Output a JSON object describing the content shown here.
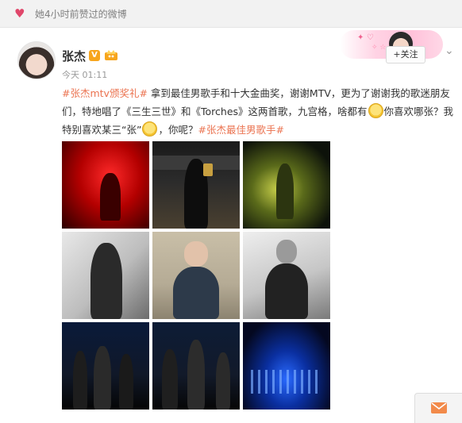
{
  "topbar": {
    "text": "她4小时前赞过的微博"
  },
  "post": {
    "username": "张杰",
    "verified_badge": "V",
    "time": "今天 01:11",
    "follow_label": "+关注",
    "hashtag_1": "#张杰mtv颁奖礼#",
    "text_part_1": " 拿到最佳男歌手和十大金曲奖，谢谢MTV，更为了谢谢我的歌迷朋友们，特地唱了《三生三世》和《Torches》这两首歌，九宫格，啥都有",
    "text_part_2": "你喜欢哪张？我特别喜欢某三“张”",
    "text_part_3": "，你呢？",
    "hashtag_2": "#张杰最佳男歌手#"
  },
  "photos": [
    "photo-red-stage",
    "photo-award-backdrop",
    "photo-green-stage",
    "photo-bw-portrait-1",
    "photo-portrait-sofa",
    "photo-bw-portrait-2",
    "photo-stage-group-1",
    "photo-stage-group-2",
    "photo-blue-stage"
  ],
  "colors": {
    "link": "#eb7350",
    "follow_plus": "#ff8200",
    "vip_badge": "#f7a51c"
  }
}
